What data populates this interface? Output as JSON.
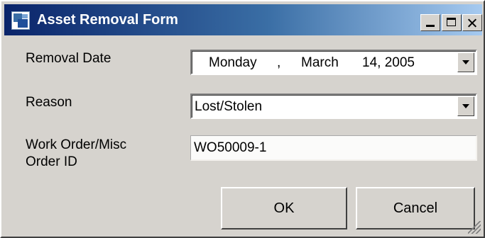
{
  "window": {
    "title": "Asset Removal Form",
    "icons": {
      "app": "app-icon",
      "minimize": "minimize-icon",
      "maximize": "maximize-icon",
      "close": "close-icon"
    },
    "colors": {
      "titlebar_start": "#0a246a",
      "titlebar_end": "#a6caf0",
      "face": "#d6d3ce"
    }
  },
  "form": {
    "removal_date": {
      "label": "Removal Date",
      "day": "Monday",
      "separator": ",",
      "month": "March",
      "date": "14, 2005"
    },
    "reason": {
      "label": "Reason",
      "value": "Lost/Stolen"
    },
    "work_order": {
      "label_line1": "Work Order/Misc",
      "label_line2": "Order ID",
      "value": "WO50009-1"
    }
  },
  "buttons": {
    "ok": "OK",
    "cancel": "Cancel"
  }
}
